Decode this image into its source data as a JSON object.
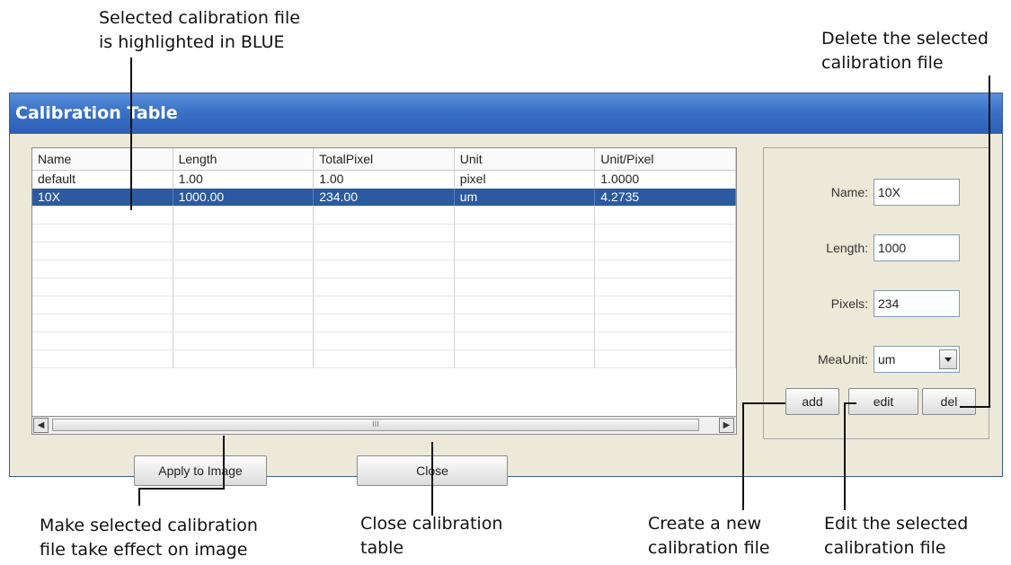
{
  "annotations": {
    "selected_note": "Selected calibration file\nis highlighted in BLUE",
    "delete_note": "Delete the selected\ncalibration file",
    "apply_note": "Make selected calibration\nfile take effect on image",
    "close_note": "Close calibration\ntable",
    "add_note": "Create a new\ncalibration file",
    "edit_note": "Edit the selected\ncalibration file"
  },
  "window": {
    "title": "Calibration Table"
  },
  "table": {
    "columns": [
      "Name",
      "Length",
      "TotalPixel",
      "Unit",
      "Unit/Pixel"
    ],
    "rows": [
      [
        "default",
        "1.00",
        "1.00",
        "pixel",
        "1.0000"
      ],
      [
        "10X",
        "1000.00",
        "234.00",
        "um",
        "4.2735"
      ],
      [
        "",
        "",
        "",
        "",
        ""
      ],
      [
        "",
        "",
        "",
        "",
        ""
      ],
      [
        "",
        "",
        "",
        "",
        ""
      ],
      [
        "",
        "",
        "",
        "",
        ""
      ],
      [
        "",
        "",
        "",
        "",
        ""
      ],
      [
        "",
        "",
        "",
        "",
        ""
      ],
      [
        "",
        "",
        "",
        "",
        ""
      ],
      [
        "",
        "",
        "",
        "",
        ""
      ],
      [
        "",
        "",
        "",
        "",
        ""
      ]
    ],
    "selected_row": 1,
    "selection_color": "#2c5aa0",
    "scroll_thumb_grip": "III",
    "scroll_left_icon": "scroll-left-icon",
    "scroll_right_icon": "scroll-right-icon"
  },
  "buttons": {
    "apply": "Apply to Image",
    "close": "Close",
    "add": "add",
    "edit": "edit",
    "del": "del"
  },
  "form": {
    "name_label": "Name:",
    "name_value": "10X",
    "length_label": "Length:",
    "length_value": "1000",
    "pixels_label": "Pixels:",
    "pixels_value": "234",
    "meaunit_label": "MeaUnit:",
    "meaunit_value": "um"
  },
  "colors": {
    "titlebar": "#3a72c8",
    "selection": "#2c5aa0",
    "window_bg": "#ece9d8"
  }
}
